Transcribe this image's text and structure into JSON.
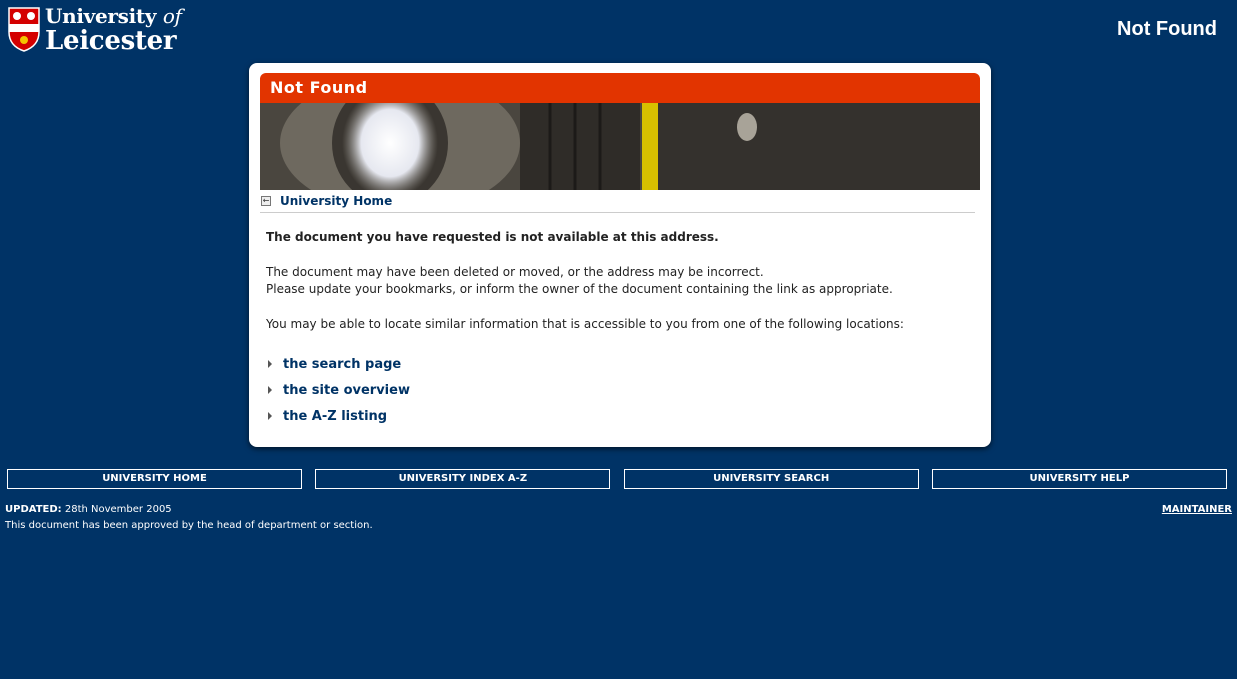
{
  "logo": {
    "line1_prefix": "University ",
    "line1_of": "of",
    "line2": "Leicester"
  },
  "header": {
    "title": "Not Found"
  },
  "card": {
    "title": "Not Found",
    "home_link": "University Home",
    "lead": "The document you have requested is not available at this address.",
    "para2_line1": "The document may have been deleted or moved, or the address may be incorrect.",
    "para2_line2": "Please update your bookmarks, or inform the owner of the document containing the link as appropriate.",
    "para3": "You may be able to locate similar information that is accessible to you from one of the following locations:",
    "links": [
      "the search page",
      "the site overview",
      "the A-Z listing"
    ]
  },
  "nav": [
    "UNIVERSITY HOME",
    "UNIVERSITY INDEX A-Z",
    "UNIVERSITY SEARCH",
    "UNIVERSITY HELP"
  ],
  "footer": {
    "updated_label": "UPDATED:",
    "updated_date": " 28th November 2005",
    "approval": "This document has been approved by the head of department or section.",
    "maintainer": "MAINTAINER"
  },
  "colors": {
    "background": "#003366",
    "title_bar": "#e23400",
    "link": "#003366"
  }
}
